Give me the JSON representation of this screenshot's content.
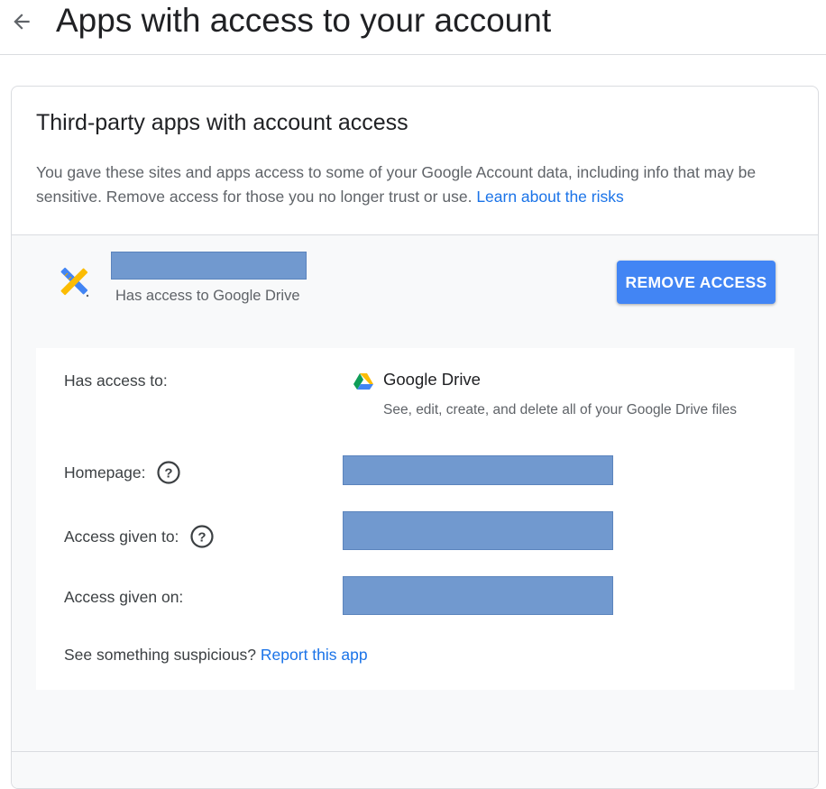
{
  "header": {
    "title": "Apps with access to your account",
    "back_icon": "arrow-back-icon"
  },
  "card": {
    "title": "Third-party apps with account access",
    "description": "You gave these sites and apps access to some of your Google Account data, including info that may be sensitive. Remove access for those you no longer trust or use.",
    "learn_link": "Learn about the risks"
  },
  "app": {
    "icon": "pencil-ruler-icon",
    "subtitle": "Has access to Google Drive",
    "remove_label": "REMOVE ACCESS"
  },
  "details": {
    "access_label": "Has access to:",
    "service_name": "Google Drive",
    "service_icon": "google-drive-icon",
    "service_desc": "See, edit, create, and delete all of your Google Drive files",
    "homepage_label": "Homepage:",
    "given_to_label": "Access given to:",
    "given_on_label": "Access given on:",
    "help_icon": "help-circle-icon",
    "suspicious_text": "See something suspicious?",
    "report_link": "Report this app"
  },
  "colors": {
    "accent": "#4285f4",
    "link": "#1a73e8",
    "redaction": "#7199cf"
  }
}
